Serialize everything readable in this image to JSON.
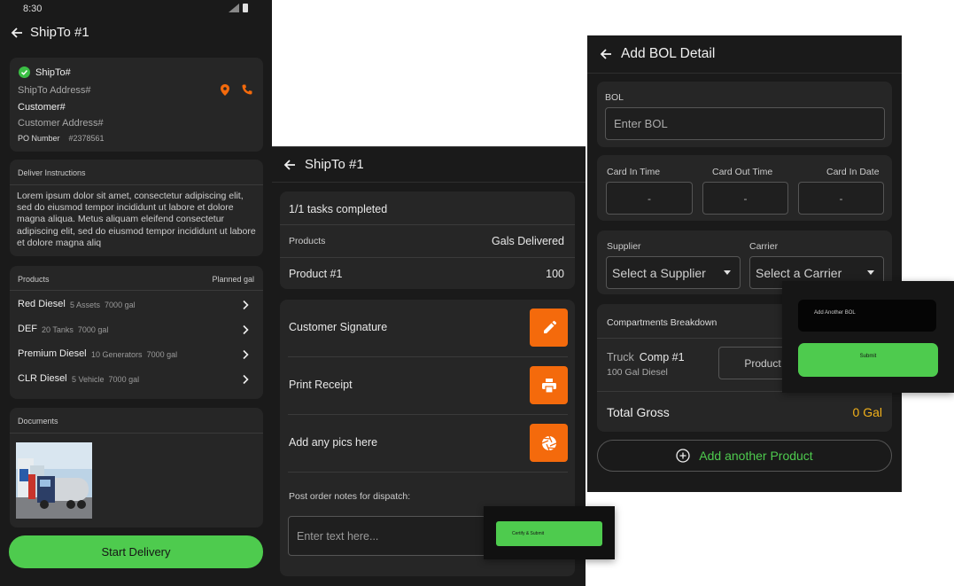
{
  "screen1": {
    "status_time": "8:30",
    "title": "ShipTo #1",
    "shipto": {
      "label": "ShipTo#",
      "address": "ShipTo Address#",
      "customer": "Customer#",
      "customer_address": "Customer Address#",
      "po_label": "PO Number",
      "po_value": "#2378561"
    },
    "instructions": {
      "header": "Deliver Instructions",
      "text": "Lorem ipsum dolor sit amet, consectetur adipiscing elit, sed do eiusmod tempor incididunt ut labore et dolore magna aliqua. Metus aliquam eleifend consectetur adipiscing elit, sed do eiusmod tempor incididunt ut labore et dolore magna aliq"
    },
    "products": {
      "header": "Products",
      "header_right": "Planned gal",
      "items": [
        {
          "name": "Red Diesel",
          "assets": "5 Assets",
          "gal": "7000 gal"
        },
        {
          "name": "DEF",
          "assets": "20 Tanks",
          "gal": "7000 gal"
        },
        {
          "name": "Premium Diesel",
          "assets": "10 Generators",
          "gal": "7000 gal"
        },
        {
          "name": "CLR Diesel",
          "assets": "5 Vehicle",
          "gal": "7000 gal"
        }
      ]
    },
    "documents": {
      "header": "Documents"
    },
    "start_button": "Start Delivery"
  },
  "screen2": {
    "title": "ShipTo #1",
    "tasks": "1/1 tasks completed",
    "products_header": "Products",
    "gals_header": "Gals Delivered",
    "product_name": "Product #1",
    "product_gals": "100",
    "actions": [
      {
        "label": "Customer Signature",
        "icon": "pencil-icon"
      },
      {
        "label": "Print Receipt",
        "icon": "printer-icon"
      },
      {
        "label": "Add any pics here",
        "icon": "camera-shutter-icon"
      }
    ],
    "notes_label": "Post order notes for dispatch:",
    "notes_placeholder": "Enter  text here...",
    "certify_button": "Certify & Submit"
  },
  "screen3": {
    "title": "Add BOL Detail",
    "bol_label": "BOL",
    "bol_placeholder": "Enter BOL",
    "card_in_time_label": "Card In Time",
    "card_out_time_label": "Card Out Time",
    "card_in_date_label": "Card In Date",
    "card_in_time_value": "-",
    "card_out_time_value": "-",
    "card_in_date_value": "-",
    "supplier_label": "Supplier",
    "supplier_value": "Select a Supplier",
    "carrier_label": "Carrier",
    "carrier_value": "Select a Carrier",
    "compartments_header": "Compartments Breakdown",
    "truck_label": "Truck",
    "comp_label": "Comp #1",
    "comp_detail": "100 Gal Diesel",
    "product_button": "Product",
    "total_label": "Total Gross",
    "total_value": "0 Gal",
    "add_product": "Add another Product",
    "add_bol_button": "Add Another BOL",
    "submit_button": "Submit"
  },
  "colors": {
    "accent_orange": "#f46a0c",
    "accent_green": "#4ecb4e",
    "total_yellow": "#f2b11a",
    "check_green": "#3bbf45"
  }
}
